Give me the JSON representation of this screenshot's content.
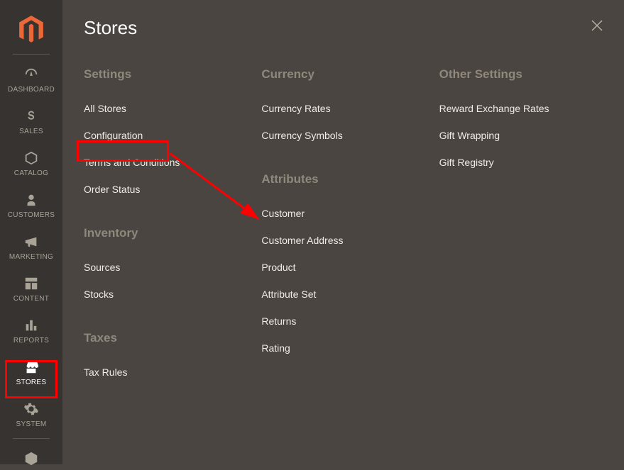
{
  "sidebar": {
    "items": [
      {
        "label": "DASHBOARD"
      },
      {
        "label": "SALES"
      },
      {
        "label": "CATALOG"
      },
      {
        "label": "CUSTOMERS"
      },
      {
        "label": "MARKETING"
      },
      {
        "label": "CONTENT"
      },
      {
        "label": "REPORTS"
      },
      {
        "label": "STORES"
      },
      {
        "label": "SYSTEM"
      }
    ]
  },
  "panel": {
    "title": "Stores",
    "columns": [
      {
        "groups": [
          {
            "heading": "Settings",
            "items": [
              "All Stores",
              "Configuration",
              "Terms and Conditions",
              "Order Status"
            ]
          },
          {
            "heading": "Inventory",
            "items": [
              "Sources",
              "Stocks"
            ]
          },
          {
            "heading": "Taxes",
            "items": [
              "Tax Rules"
            ]
          }
        ]
      },
      {
        "groups": [
          {
            "heading": "Currency",
            "items": [
              "Currency Rates",
              "Currency Symbols"
            ]
          },
          {
            "heading": "Attributes",
            "items": [
              "Customer",
              "Customer Address",
              "Product",
              "Attribute Set",
              "Returns",
              "Rating"
            ]
          }
        ]
      },
      {
        "groups": [
          {
            "heading": "Other Settings",
            "items": [
              "Reward Exchange Rates",
              "Gift Wrapping",
              "Gift Registry"
            ]
          }
        ]
      }
    ]
  }
}
